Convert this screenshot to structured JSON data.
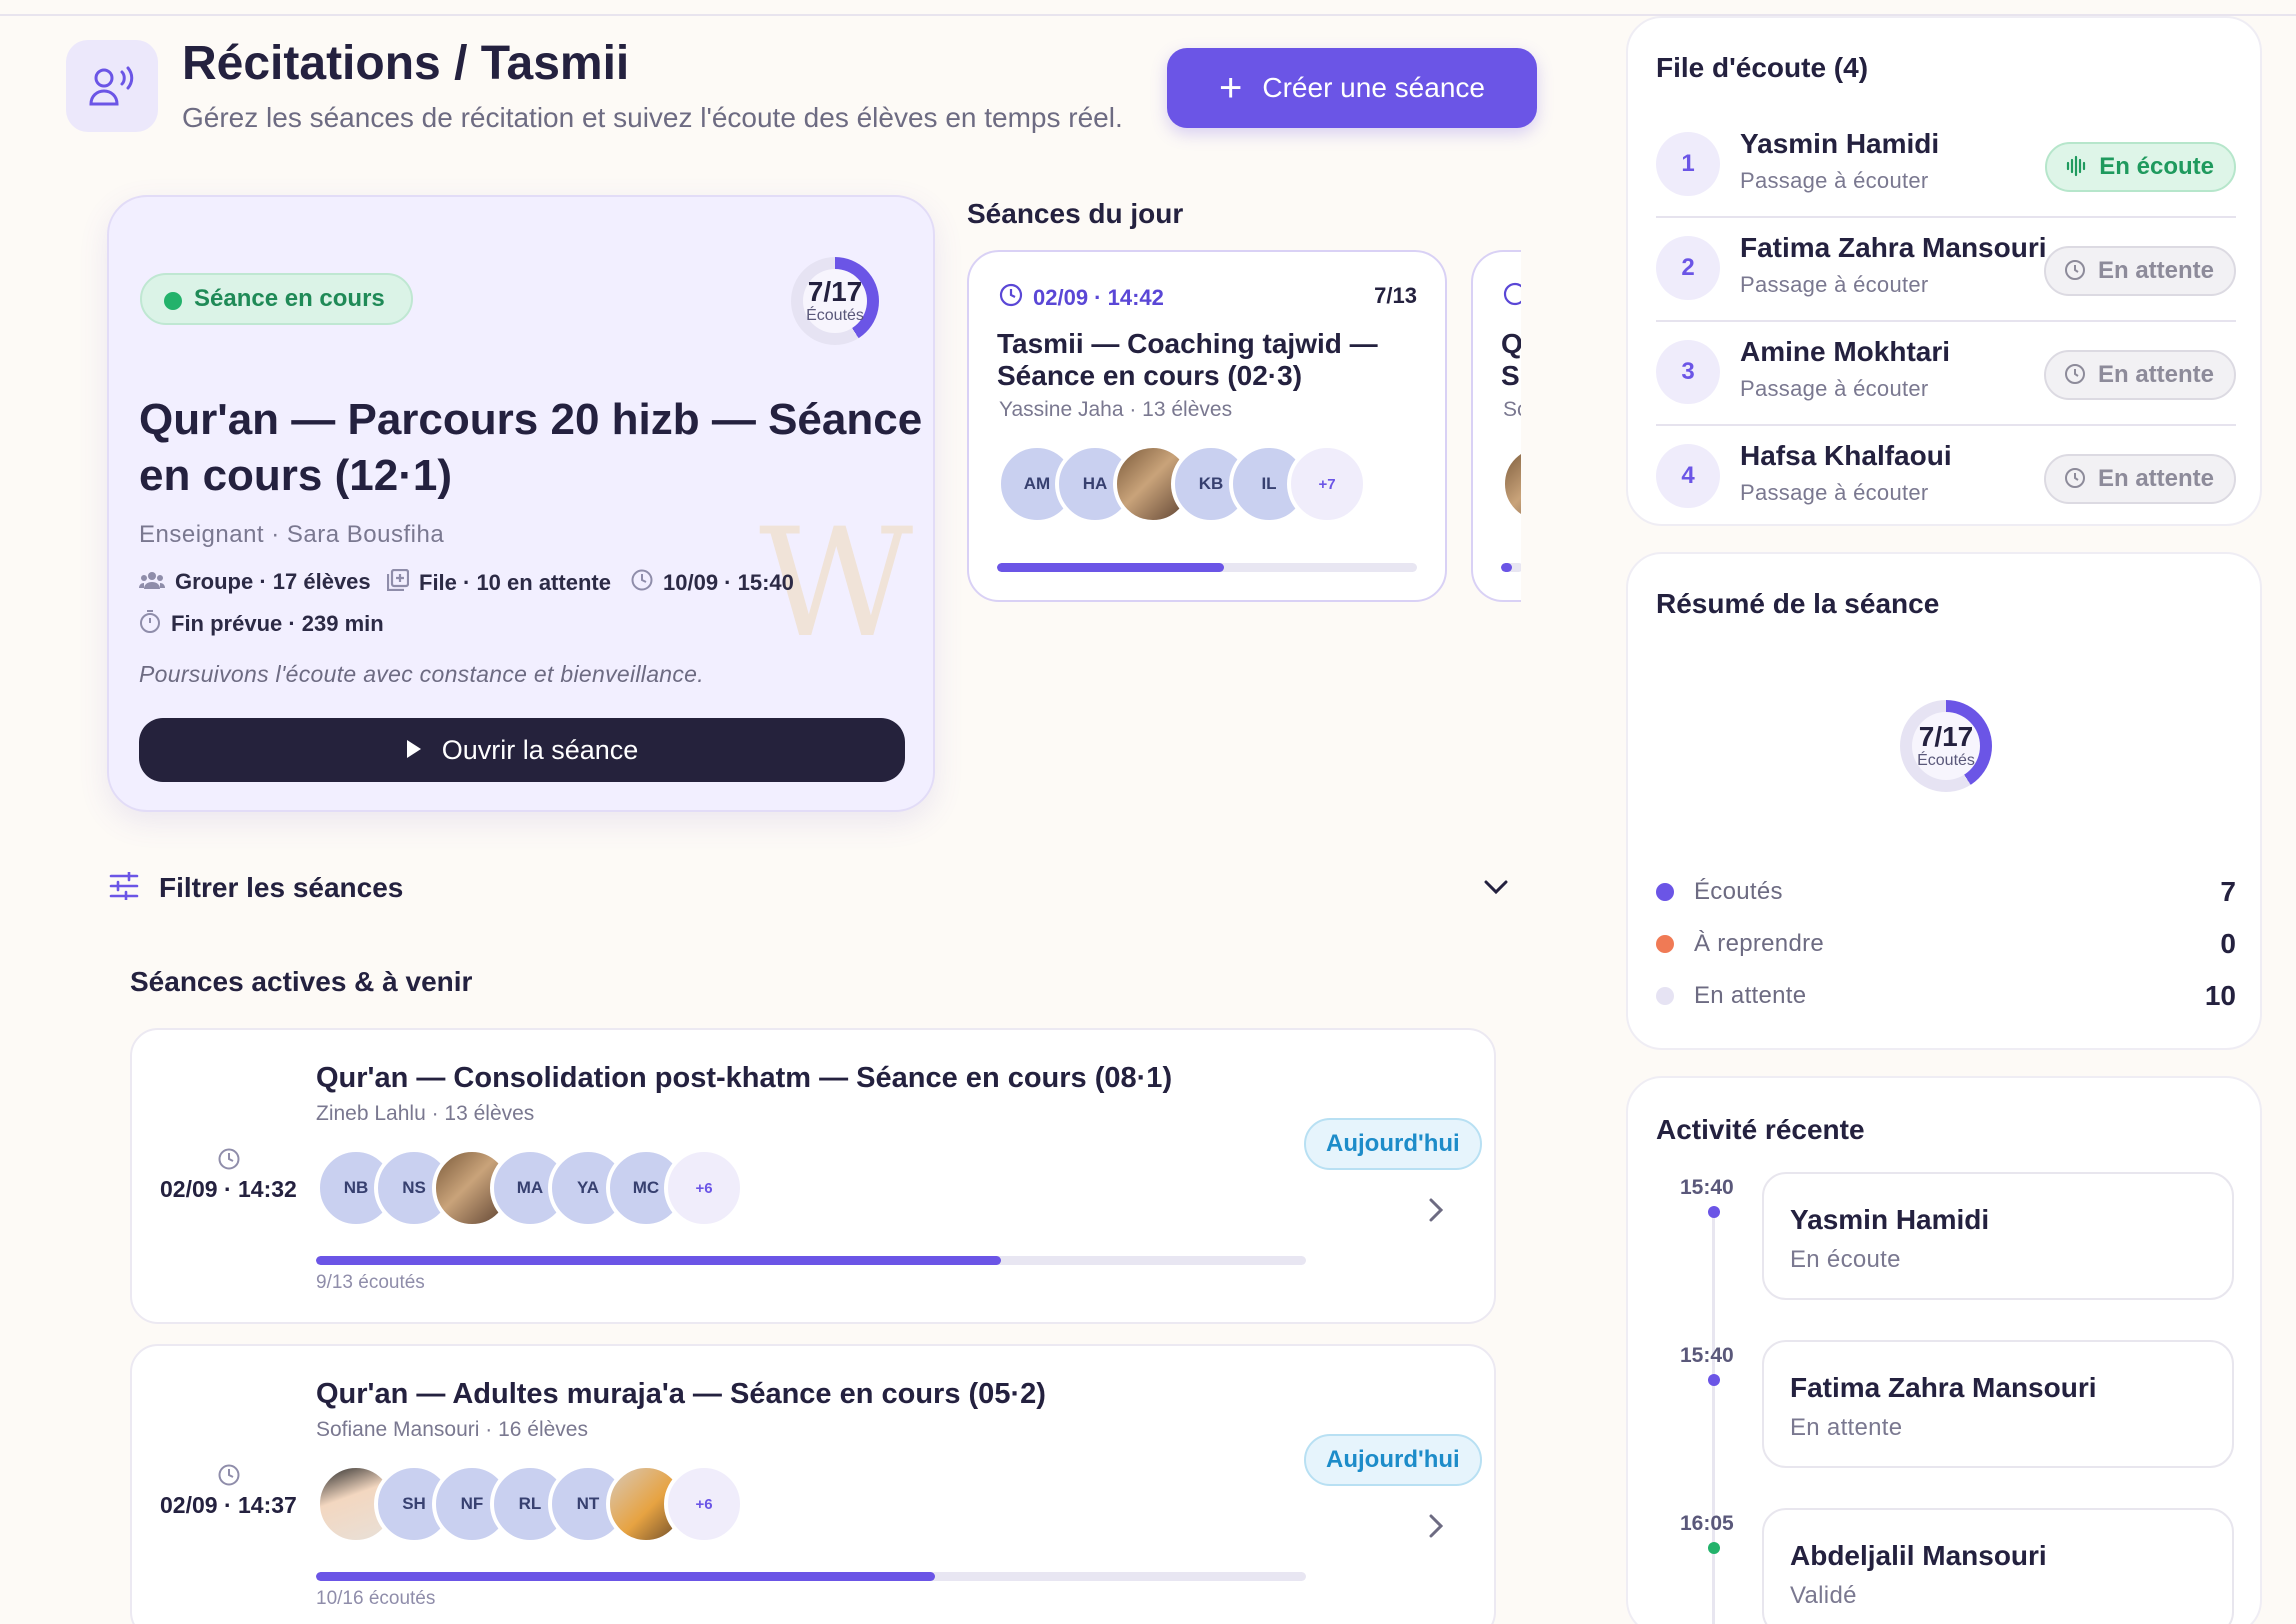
{
  "header": {
    "title": "Récitations / Tasmii",
    "subtitle": "Gérez les séances de récitation et suivez l'écoute des élèves en temps réel.",
    "create_button": "Créer une séance"
  },
  "hero": {
    "status": "Séance en cours",
    "progress_value": "7/17",
    "progress_label": "Écoutés",
    "progress_fraction": 0.41,
    "title": "Qur'an — Parcours 20 hizb — Séance en cours (12·1)",
    "teacher": "Enseignant · Sara Bousfiha",
    "group": "Groupe · 17 élèves",
    "queue": "File · 10 en attente",
    "datetime": "10/09 · 15:40",
    "end": "Fin prévue · 239 min",
    "quote": "Poursuivons l'écoute avec constance et bienveillance.",
    "open_button": "Ouvrir la séance"
  },
  "today": {
    "heading": "Séances du jour",
    "cards": [
      {
        "time": "02/09 · 14:42",
        "count": "7/13",
        "title": "Tasmii — Coaching tajwid — Séance en cours (02·3)",
        "sub": "Yassine Jaha · 13 élèves",
        "avatars": [
          "AM",
          "HA",
          "",
          "KB",
          "IL",
          "+7"
        ],
        "progress": 0.54
      },
      {
        "time": "",
        "count": "",
        "title": "Q S",
        "sub": "Sc",
        "avatars": [
          ""
        ],
        "progress": 0.5
      }
    ]
  },
  "filter": {
    "label": "Filtrer les séances"
  },
  "sessions": {
    "heading": "Séances actives & à venir",
    "items": [
      {
        "date": "02/09 · 14:32",
        "title": "Qur'an — Consolidation post-khatm — Séance en cours (08·1)",
        "sub": "Zineb Lahlu · 13 élèves",
        "badge": "Aujourd'hui",
        "avatars": [
          "NB",
          "NS",
          "",
          "MA",
          "YA",
          "MC",
          "+6"
        ],
        "progress": 0.6923,
        "count": "9/13 écoutés"
      },
      {
        "date": "02/09 · 14:37",
        "title": "Qur'an — Adultes muraja'a — Séance en cours (05·2)",
        "sub": "Sofiane Mansouri · 16 élèves",
        "badge": "Aujourd'hui",
        "avatars": [
          "",
          "SH",
          "NF",
          "RL",
          "NT",
          "",
          "+6"
        ],
        "progress": 0.625,
        "count": "10/16 écoutés"
      }
    ]
  },
  "queue": {
    "title": "File d'écoute (4)",
    "items": [
      {
        "num": "1",
        "name": "Yasmin Hamidi",
        "sub": "Passage à écouter",
        "status": "En écoute",
        "state": "listen"
      },
      {
        "num": "2",
        "name": "Fatima Zahra Mansouri",
        "sub": "Passage à écouter",
        "status": "En attente",
        "state": "wait"
      },
      {
        "num": "3",
        "name": "Amine Mokhtari",
        "sub": "Passage à écouter",
        "status": "En attente",
        "state": "wait"
      },
      {
        "num": "4",
        "name": "Hafsa Khalfaoui",
        "sub": "Passage à écouter",
        "status": "En attente",
        "state": "wait"
      }
    ]
  },
  "summary": {
    "title": "Résumé de la séance",
    "ring_value": "7/17",
    "ring_label": "Écoutés",
    "ring_fraction": 0.41,
    "legend": [
      {
        "name": "Écoutés",
        "value": "7",
        "color": "#6b55e6"
      },
      {
        "name": "À reprendre",
        "value": "0",
        "color": "#f07a55"
      },
      {
        "name": "En attente",
        "value": "10",
        "color": "#e6e3f3"
      }
    ]
  },
  "activity": {
    "title": "Activité récente",
    "items": [
      {
        "time": "15:40",
        "name": "Yasmin Hamidi",
        "status": "En écoute",
        "color": "#6b55e6"
      },
      {
        "time": "15:40",
        "name": "Fatima Zahra Mansouri",
        "status": "En attente",
        "color": "#6b55e6"
      },
      {
        "time": "16:05",
        "name": "Abdeljalil Mansouri",
        "status": "Validé",
        "color": "#23b26b"
      }
    ]
  },
  "colors": {
    "accent": "#6b55e6",
    "success": "#23b26b",
    "dark": "#25223c"
  }
}
